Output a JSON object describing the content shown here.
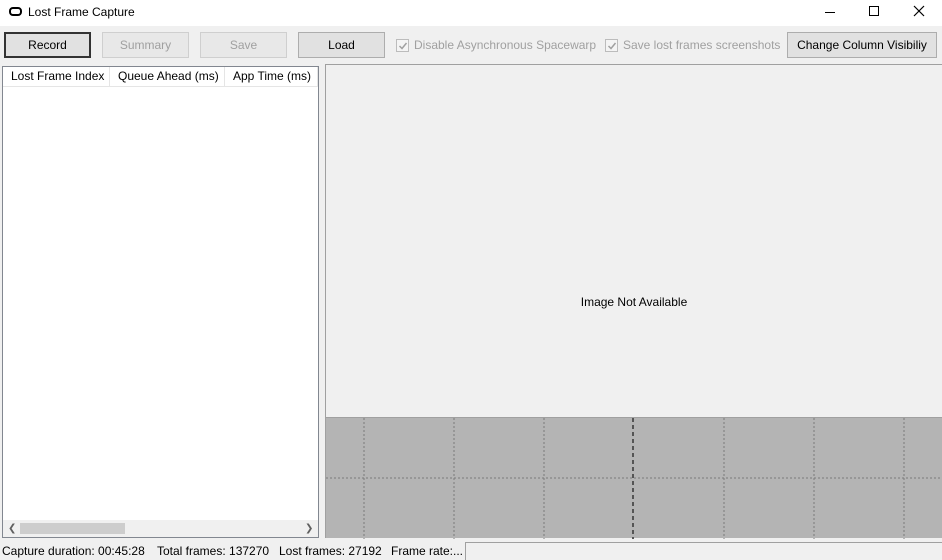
{
  "window": {
    "title": "Lost Frame Capture",
    "controls": [
      "minimize-icon",
      "maximize-icon",
      "close-icon"
    ]
  },
  "toolbar": {
    "record_label": "Record",
    "summary_label": "Summary",
    "save_label": "Save",
    "load_label": "Load",
    "disable_asw_label": "Disable Asynchronous Spacewarp",
    "disable_asw_checked": true,
    "save_screenshots_label": "Save lost frames screenshots",
    "save_screenshots_checked": true,
    "column_visibility_label": "Change Column Visibiliy"
  },
  "list": {
    "columns": [
      "Lost Frame Index",
      "Queue Ahead (ms)",
      "App Time (ms)"
    ],
    "rows": []
  },
  "image_pane": {
    "message": "Image Not Available"
  },
  "status": {
    "capture_duration": "Capture duration: 00:45:28",
    "total_frames": "Total frames: 137270",
    "lost_frames": "Lost frames: 27192",
    "frame_rate": "Frame rate:..."
  }
}
